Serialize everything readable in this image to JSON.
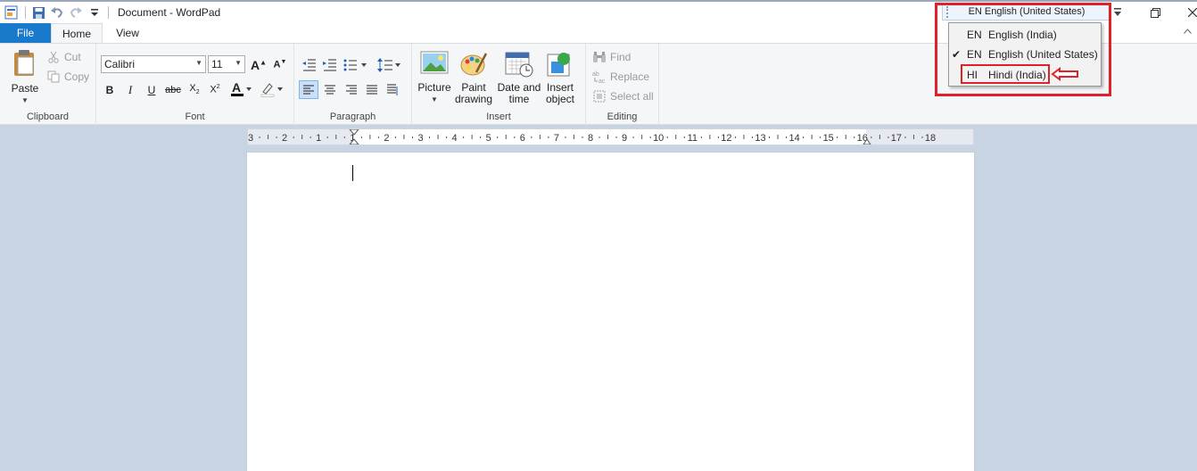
{
  "window": {
    "title": "Document - WordPad"
  },
  "tabs": [
    {
      "label": "File"
    },
    {
      "label": "Home"
    },
    {
      "label": "View"
    }
  ],
  "clipboard": {
    "group_label": "Clipboard",
    "paste": "Paste",
    "cut": "Cut",
    "copy": "Copy"
  },
  "font": {
    "group_label": "Font",
    "family": "Calibri",
    "size": "11"
  },
  "paragraph": {
    "group_label": "Paragraph"
  },
  "insert": {
    "group_label": "Insert",
    "picture": "Picture",
    "paint_line1": "Paint",
    "paint_line2": "drawing",
    "date_line1": "Date and",
    "date_line2": "time",
    "object_line1": "Insert",
    "object_line2": "object"
  },
  "editing": {
    "group_label": "Editing",
    "find": "Find",
    "replace": "Replace",
    "select_all": "Select all"
  },
  "ruler": {
    "labels": [
      "3",
      "2",
      "1",
      "1",
      "2",
      "3",
      "4",
      "5",
      "6",
      "7",
      "8",
      "9",
      "10",
      "11",
      "12",
      "13",
      "14",
      "15",
      "16",
      "17",
      "18"
    ]
  },
  "language_bar": {
    "current": "EN English (United States)",
    "items": [
      {
        "code": "EN",
        "name": "English (India)",
        "checked": false
      },
      {
        "code": "EN",
        "name": "English (United States)",
        "checked": true
      },
      {
        "code": "HI",
        "name": "Hindi (India)",
        "checked": false
      }
    ],
    "check_glyph": "✔"
  },
  "colors": {
    "file_tab": "#1979ca",
    "highlight": "#e0202a",
    "ribbon_bg": "#f5f6f7",
    "workspace_bg": "#c9d4e3"
  }
}
